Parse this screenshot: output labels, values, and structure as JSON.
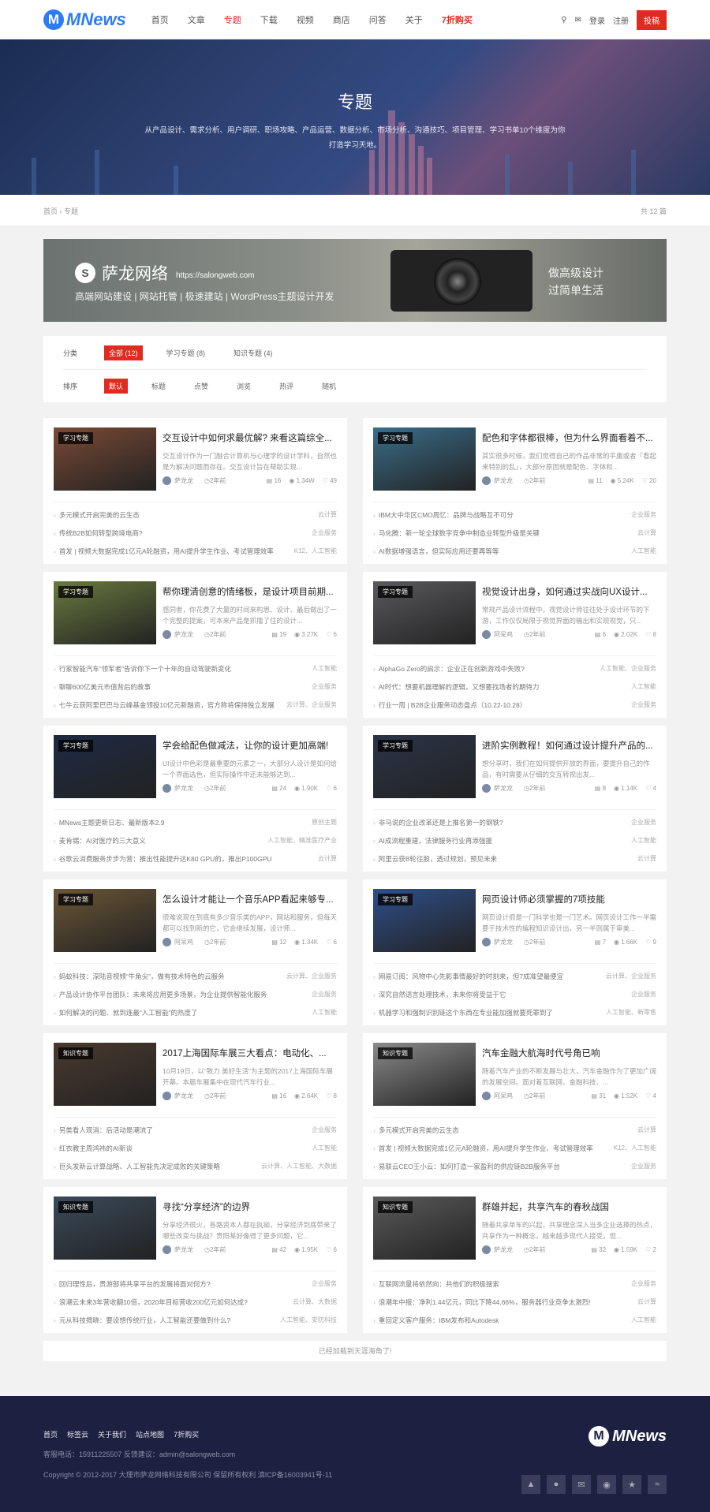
{
  "header": {
    "logo": "MNews",
    "nav": [
      "首页",
      "文章",
      "专题",
      "下载",
      "视频",
      "商店",
      "问答",
      "关于",
      "7折购买"
    ],
    "login": "登录",
    "register": "注册",
    "submit": "投稿"
  },
  "banner": {
    "title": "专题",
    "desc": "从产品设计、需求分析、用户调研、职场攻略、产品运营、数据分析、市场分析、沟通技巧、项目管理、学习书单10个维度为你打造学习天地。"
  },
  "crumb": {
    "path": "首页 › 专题",
    "count": "共 12 篇"
  },
  "ad": {
    "brand": "萨龙网络",
    "url": "https://salongweb.com",
    "sub": "高端网站建设 | 网站托管 | 极速建站 | WordPress主题设计开发",
    "right1": "做高级设计",
    "right2": "过简单生活"
  },
  "filter": {
    "cat_label": "分类",
    "cats": [
      "全部 (12)",
      "学习专题 (8)",
      "知识专题 (4)"
    ],
    "sort_label": "排序",
    "sorts": [
      "默认",
      "标题",
      "点赞",
      "浏览",
      "热评",
      "随机"
    ]
  },
  "cards": [
    {
      "tag": "学习专题",
      "title": "交互设计中如何求最优解? 来看这篇综全...",
      "excerpt": "交互设计作为一门融合计算机与心理学的设计学科，自然也是为解决问题而存在。交互设计旨在帮助实现...",
      "author": "萨龙龙",
      "time": "2年前",
      "c1": "16",
      "c2": "1.34W",
      "c3": "49",
      "img": "#7a4a35",
      "items": [
        [
          "多元模式开启完美的云生态",
          "云计算"
        ],
        [
          "传统B2B如何转型跨境电商?",
          "企业服务"
        ],
        [
          "首发 | 视频大数据完成1亿元A轮融资，用AI提升学生作业、考试管理效率",
          "K12、人工智能"
        ]
      ]
    },
    {
      "tag": "学习专题",
      "title": "配色和字体都很棒，但为什么界面看着不...",
      "excerpt": "其实很多时候，我们觉得自己的作品非常的平庸或者『看起来特别的乱』，大部分原因就是配色、字体和...",
      "author": "萨龙龙",
      "time": "2年前",
      "c1": "11",
      "c2": "5.24K",
      "c3": "20",
      "img": "#3a6e8a",
      "items": [
        [
          "IBM大中华区CMO周忆：品牌与战略互不可分",
          "企业服务"
        ],
        [
          "马化腾：新一轮全球数字竞争中制造业转型升级是关键",
          "云计算"
        ],
        [
          "AI数据增强语言，但实际应用还要再等等",
          "人工智能"
        ]
      ]
    },
    {
      "tag": "学习专题",
      "title": "帮你理清创意的情绪板，是设计项目前期...",
      "excerpt": "感同者，你花费了大量的时间来构思、设计、最后做出了一个完整的提案，可本来产品是抓撸了住的设计...",
      "author": "萨龙龙",
      "time": "2年前",
      "c1": "19",
      "c2": "3.27K",
      "c3": "6",
      "img": "#6a7a3e",
      "items": [
        [
          "行家智能汽车“领军者”告诉你下一个十年的自动驾驶新变化",
          "人工智能"
        ],
        [
          "聊聊600亿美元市值背后的故事",
          "企业服务"
        ],
        [
          "七牛云获阿里巴巴与云峰基金领投10亿元新融资，官方称将保持独立发展",
          "云计算、企业服务"
        ]
      ]
    },
    {
      "tag": "学习专题",
      "title": "视觉设计出身，如何通过实战向UX设计...",
      "excerpt": "常规产品设计流程中，视觉设计师往往处于设计环节的下游，工作仅仅局限于视觉界面的输出和实现视觉，只...",
      "author": "阿呆鸡",
      "time": "2年前",
      "c1": "6",
      "c2": "2.02K",
      "c3": "8",
      "img": "#5a5a5e",
      "items": [
        [
          "AlphaGo Zero的启示：企业正在创新游戏中失败?",
          "人工智能、企业服务"
        ],
        [
          "AI时代：想要机器理解的逻辑，又想要找场者的期待力",
          "人工智能"
        ],
        [
          "行业一周 | B2B企业服务动态盘点（10.22-10.28）",
          "企业服务"
        ]
      ]
    },
    {
      "tag": "学习专题",
      "title": "学会给配色做减法，让你的设计更加高端!",
      "excerpt": "UI设计中色彩是最重要的元素之一，大部分人设计是如何给一个界面选色，但实际操作中还未能够达到...",
      "author": "萨龙龙",
      "time": "2年前",
      "c1": "24",
      "c2": "1.90K",
      "c3": "6",
      "img": "#1e2a44",
      "items": [
        [
          "MNews主题更新日志、最新版本2.9",
          "原创主题"
        ],
        [
          "麦肯锡：AI对医疗的三大意义",
          "人工智能、精准医疗产业"
        ],
        [
          "谷歌云消费服务步步为营：推出性能提升达K80 GPU的，推出P100GPU",
          "云计算"
        ]
      ]
    },
    {
      "tag": "学习专题",
      "title": "进阶实例教程！如何通过设计提升产品的...",
      "excerpt": "想分享时，我们在如何提供开放的界面，要提升自己的作品，有时需要从仔细的交互转视出发...",
      "author": "萨龙龙",
      "time": "2年前",
      "c1": "8",
      "c2": "1.14K",
      "c3": "4",
      "img": "#2b3448",
      "items": [
        [
          "非马说的企业改革还是上推名第一的钢铁?",
          "企业服务"
        ],
        [
          "AI成流程重建，法律服务行业再添强援",
          "人工智能"
        ],
        [
          "阿里云获B轮往股，透过规划，预见未来",
          "云计算"
        ]
      ]
    },
    {
      "tag": "学习专题",
      "title": "怎么设计才能让一个音乐APP看起来够专...",
      "excerpt": "很难说现在到底有多少音乐类的APP，网站和服务，但每天都可以找到新的它，它会继续发展，设计师...",
      "author": "阿呆鸡",
      "time": "2年前",
      "c1": "12",
      "c2": "1.34K",
      "c3": "6",
      "img": "#6b5636",
      "items": [
        [
          "蚂蚁科技：深陆音视频“牛角尖”，做有技术特色的云服务",
          "云计算、企业服务"
        ],
        [
          "产品设计协作平台团队：未来将应用更多场景，为企业提供智能化服务",
          "企业服务"
        ],
        [
          "如何解决的问题、就到连最“人工智能”的热度了",
          "人工智能"
        ]
      ]
    },
    {
      "tag": "学习专题",
      "title": "网页设计师必须掌握的7项技能",
      "excerpt": "网页设计很是一门科学也是一门艺术。网页设计工作一半需要于技术性的编程知识设计出，另一半则属于审美...",
      "author": "萨龙龙",
      "time": "2年前",
      "c1": "7",
      "c2": "1.66K",
      "c3": "9",
      "img": "#2f4f8a",
      "items": [
        [
          "网易订阅：风物中心先影事情最好的时刻来，但7成准望最便宜",
          "云计算、企业服务"
        ],
        [
          "深究自然语言处理技术，未来你将受益于它",
          "企业服务"
        ],
        [
          "机器学习和强制识别链这个东西在专业能加强就要死罪到了",
          "人工智能、新零售"
        ]
      ]
    },
    {
      "tag": "知识专题",
      "title": "2017上海国际车展三大看点：电动化、...",
      "excerpt": "10月19日，以“致力 美好生活”为主题的2017上海国际车展开幕。本届车展集中在现代汽车行业...",
      "author": "萨龙龙",
      "time": "2年前",
      "c1": "16",
      "c2": "2.64K",
      "c3": "8",
      "img": "#4a3a2e",
      "items": [
        [
          "另类看人观消：后活动是潮流了",
          "企业服务"
        ],
        [
          "红衣教主周鸿祎的AI新谈",
          "人工智能"
        ],
        [
          "巨头发新云计算战略、人工智能先决定成败的关键策略",
          "云计算、人工智能、大数据"
        ]
      ]
    },
    {
      "tag": "知识专题",
      "title": "汽车金融大航海时代号角已响",
      "excerpt": "随着汽车产业的不断发展与壮大，汽车金融作为了更加广阔的发展空间。面对着互联网、金融科技、...",
      "author": "阿呆鸡",
      "time": "2年前",
      "c1": "31",
      "c2": "1.52K",
      "c3": "4",
      "img": "#8a8a8a",
      "items": [
        [
          "多元模式开启完美的云生态",
          "云计算"
        ],
        [
          "首发 | 视频大数据完成1亿元A轮融资，用AI提升学生作业、考试管理效率",
          "K12、人工智能"
        ],
        [
          "易联云CEO王小云：如何打造一家盈利的供应链B2B服务平台",
          "企业服务"
        ]
      ]
    },
    {
      "tag": "知识专题",
      "title": "寻找“分享经济”的边界",
      "excerpt": "分享经济很火，各路资本人都在执拗，分享经济到底带来了哪些改变与挑战？贵阳某好像得了更多问题，它...",
      "author": "萨龙龙",
      "time": "2年前",
      "c1": "42",
      "c2": "1.95K",
      "c3": "6",
      "img": "#3a4a5a",
      "items": [
        [
          "回归理性后，贵游部将共享平台的发展将面对何方?",
          "企业服务"
        ],
        [
          "浪潮云未来3年营收翻10倍，2020年目标营收200亿元如何达成?",
          "云计算、大数据"
        ],
        [
          "元从科技揭晓：要设想传统行业，人工智能还要做到什么?",
          "人工智能、安防科技"
        ]
      ]
    },
    {
      "tag": "知识专题",
      "title": "群雄并起，共享汽车的春秋战国",
      "excerpt": "随着共享单车的兴起，共享理念深入当多企业选择的热点，共享作为一种概念，越来越多现代人接受，但...",
      "author": "萨龙龙",
      "time": "2年前",
      "c1": "32",
      "c2": "1.59K",
      "c3": "2",
      "img": "#5a5a5a",
      "items": [
        [
          "互联网流量将依然向：共他们的积极搜索",
          "企业服务"
        ],
        [
          "浪潮年中报：净利1.44亿元，同比下降44.66%，服务器行业竞争太激烈!",
          "云计算"
        ],
        [
          "重回定义客户服务：IBM发布和Autodesk",
          "人工智能"
        ]
      ]
    }
  ],
  "more": "已经加载到天涯海角了!",
  "footer": {
    "links": [
      "首页",
      "标签云",
      "关于我们",
      "站点地图",
      "7折购买"
    ],
    "contact": "客服电话：15911225507 反馈建议：admin@salongweb.com",
    "copyright": "Copyright © 2012-2017 大理市萨龙网络科技有限公司 保留所有权利 滇ICP备16003941号-11",
    "logo": "MNews"
  }
}
